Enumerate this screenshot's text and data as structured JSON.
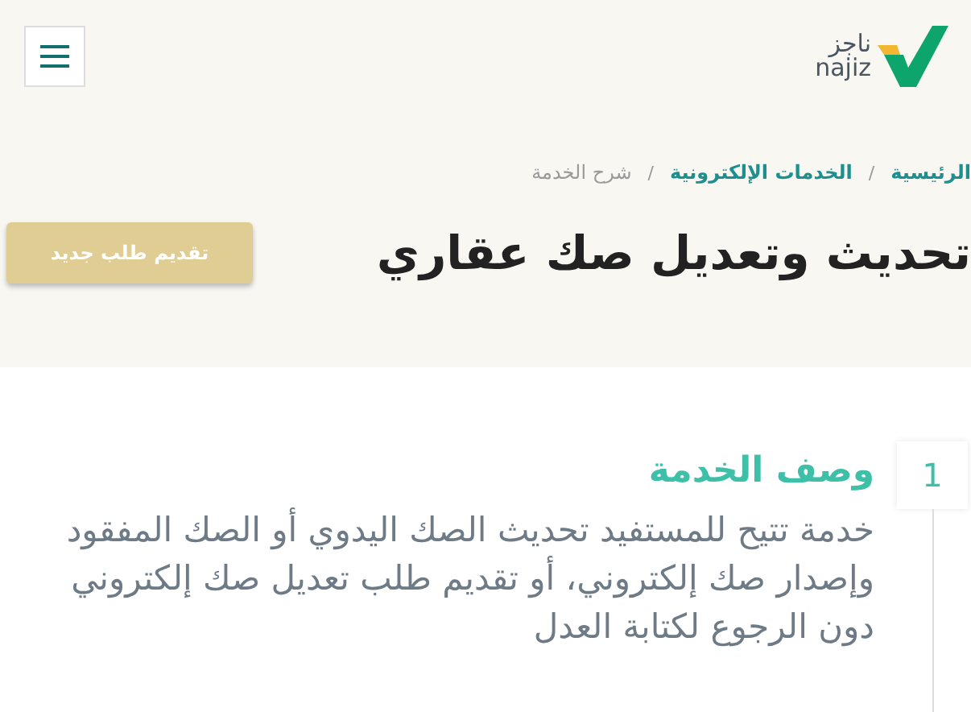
{
  "logo": {
    "arabic": "ناجز",
    "latin": "najiz"
  },
  "breadcrumbs": [
    {
      "label": "الرئيسية",
      "current": false
    },
    {
      "label": "الخدمات الإلكترونية",
      "current": false
    },
    {
      "label": "شرح الخدمة",
      "current": true
    }
  ],
  "breadcrumb_separator": "/",
  "title": "تحديث وتعديل صك عقاري",
  "primary_button": "تقديم طلب جديد",
  "steps": [
    {
      "number": "1",
      "heading": "وصف الخدمة",
      "text": "خدمة تتيح للمستفيد تحديث الصك اليدوي أو الصك المفقود وإصدار صك إلكتروني، أو تقديم طلب تعديل صك إلكتروني دون الرجوع لكتابة العدل"
    }
  ]
}
